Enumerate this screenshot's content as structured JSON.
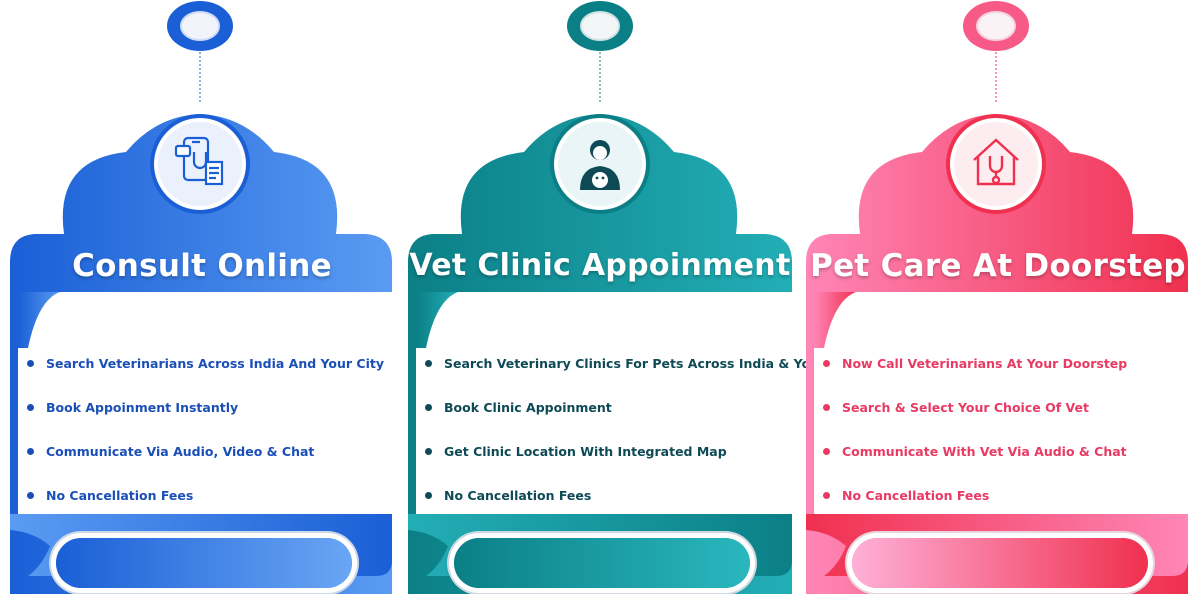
{
  "cards": [
    {
      "title": "Consult Online",
      "icon": "phone-stethoscope-icon",
      "colors": {
        "dark": "#1a5fd6",
        "light": "#5a9bf2",
        "text": "#1b4fb8",
        "dot": "#1b4fb8"
      },
      "features": [
        "Search Veterinarians Across India And Your City",
        "Book Appoinment Instantly",
        "Communicate Via Audio, Video & Chat",
        "No Cancellation Fees"
      ]
    },
    {
      "title": "Vet Clinic Appoinment",
      "icon": "veterinarian-with-dog-icon",
      "colors": {
        "dark": "#0b7f86",
        "light": "#23aeb6",
        "text": "#0e4a55",
        "dot": "#0e4a55"
      },
      "features": [
        "Search Veterinary Clinics For Pets Across India & Your City",
        "Book Clinic Appoinment",
        "Get Clinic Location With Integrated Map",
        "No Cancellation Fees"
      ]
    },
    {
      "title": "Pet Care At Doorstep",
      "icon": "home-stethoscope-icon",
      "colors": {
        "dark": "#f0304f",
        "light": "#ff86b6",
        "text": "#e93a63",
        "dot": "#e93a63"
      },
      "features": [
        "Now Call Veterinarians At Your Doorstep",
        "Search & Select Your Choice Of Vet",
        "Communicate With Vet Via Audio & Chat",
        "No Cancellation Fees"
      ]
    }
  ]
}
